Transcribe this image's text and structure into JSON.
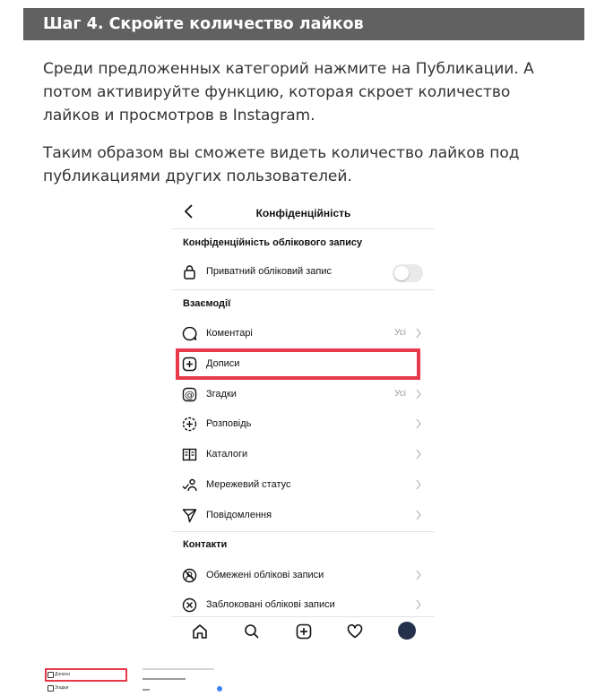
{
  "article": {
    "step_title": "Шаг 4. Скройте количество лайков",
    "paragraph1": "Среди предложенных категорий нажмите на Публикации. А потом активируйте функцию, которая скроет количество лайков и просмотров в Instagram.",
    "paragraph2": "Таким образом вы сможете видеть количество лайков под публикациями других пользователей."
  },
  "phone": {
    "title": "Конфіденційність",
    "account_section": "Конфіденційність облікового запису",
    "private_account": {
      "label": "Приватний обліковий запис",
      "enabled": false
    },
    "interactions_section": "Взаємодії",
    "interactions": [
      {
        "label": "Коментарі",
        "value": "Усі",
        "icon": "comment-icon"
      },
      {
        "label": "Дописи",
        "value": "",
        "icon": "add-post-icon"
      },
      {
        "label": "Згадки",
        "value": "Усі",
        "icon": "mention-icon"
      },
      {
        "label": "Розповідь",
        "value": "",
        "icon": "story-add-icon"
      },
      {
        "label": "Каталоги",
        "value": "",
        "icon": "guides-icon"
      },
      {
        "label": "Мережевий статус",
        "value": "",
        "icon": "activity-status-icon"
      },
      {
        "label": "Повідомлення",
        "value": "",
        "icon": "send-message-icon"
      }
    ],
    "contacts_section": "Контакти",
    "contacts": [
      {
        "label": "Обмежені облікові записи",
        "icon": "restricted-icon"
      },
      {
        "label": "Заблоковані облікові записи",
        "icon": "blocked-icon"
      }
    ],
    "nav": [
      "home-icon",
      "search-icon",
      "new-post-icon",
      "heart-icon",
      "profile-avatar"
    ],
    "highlight_color": "#e8394b"
  },
  "thumbnails": {
    "first": {
      "item1": "Дописи",
      "item2": "Згадки"
    },
    "second": {}
  }
}
